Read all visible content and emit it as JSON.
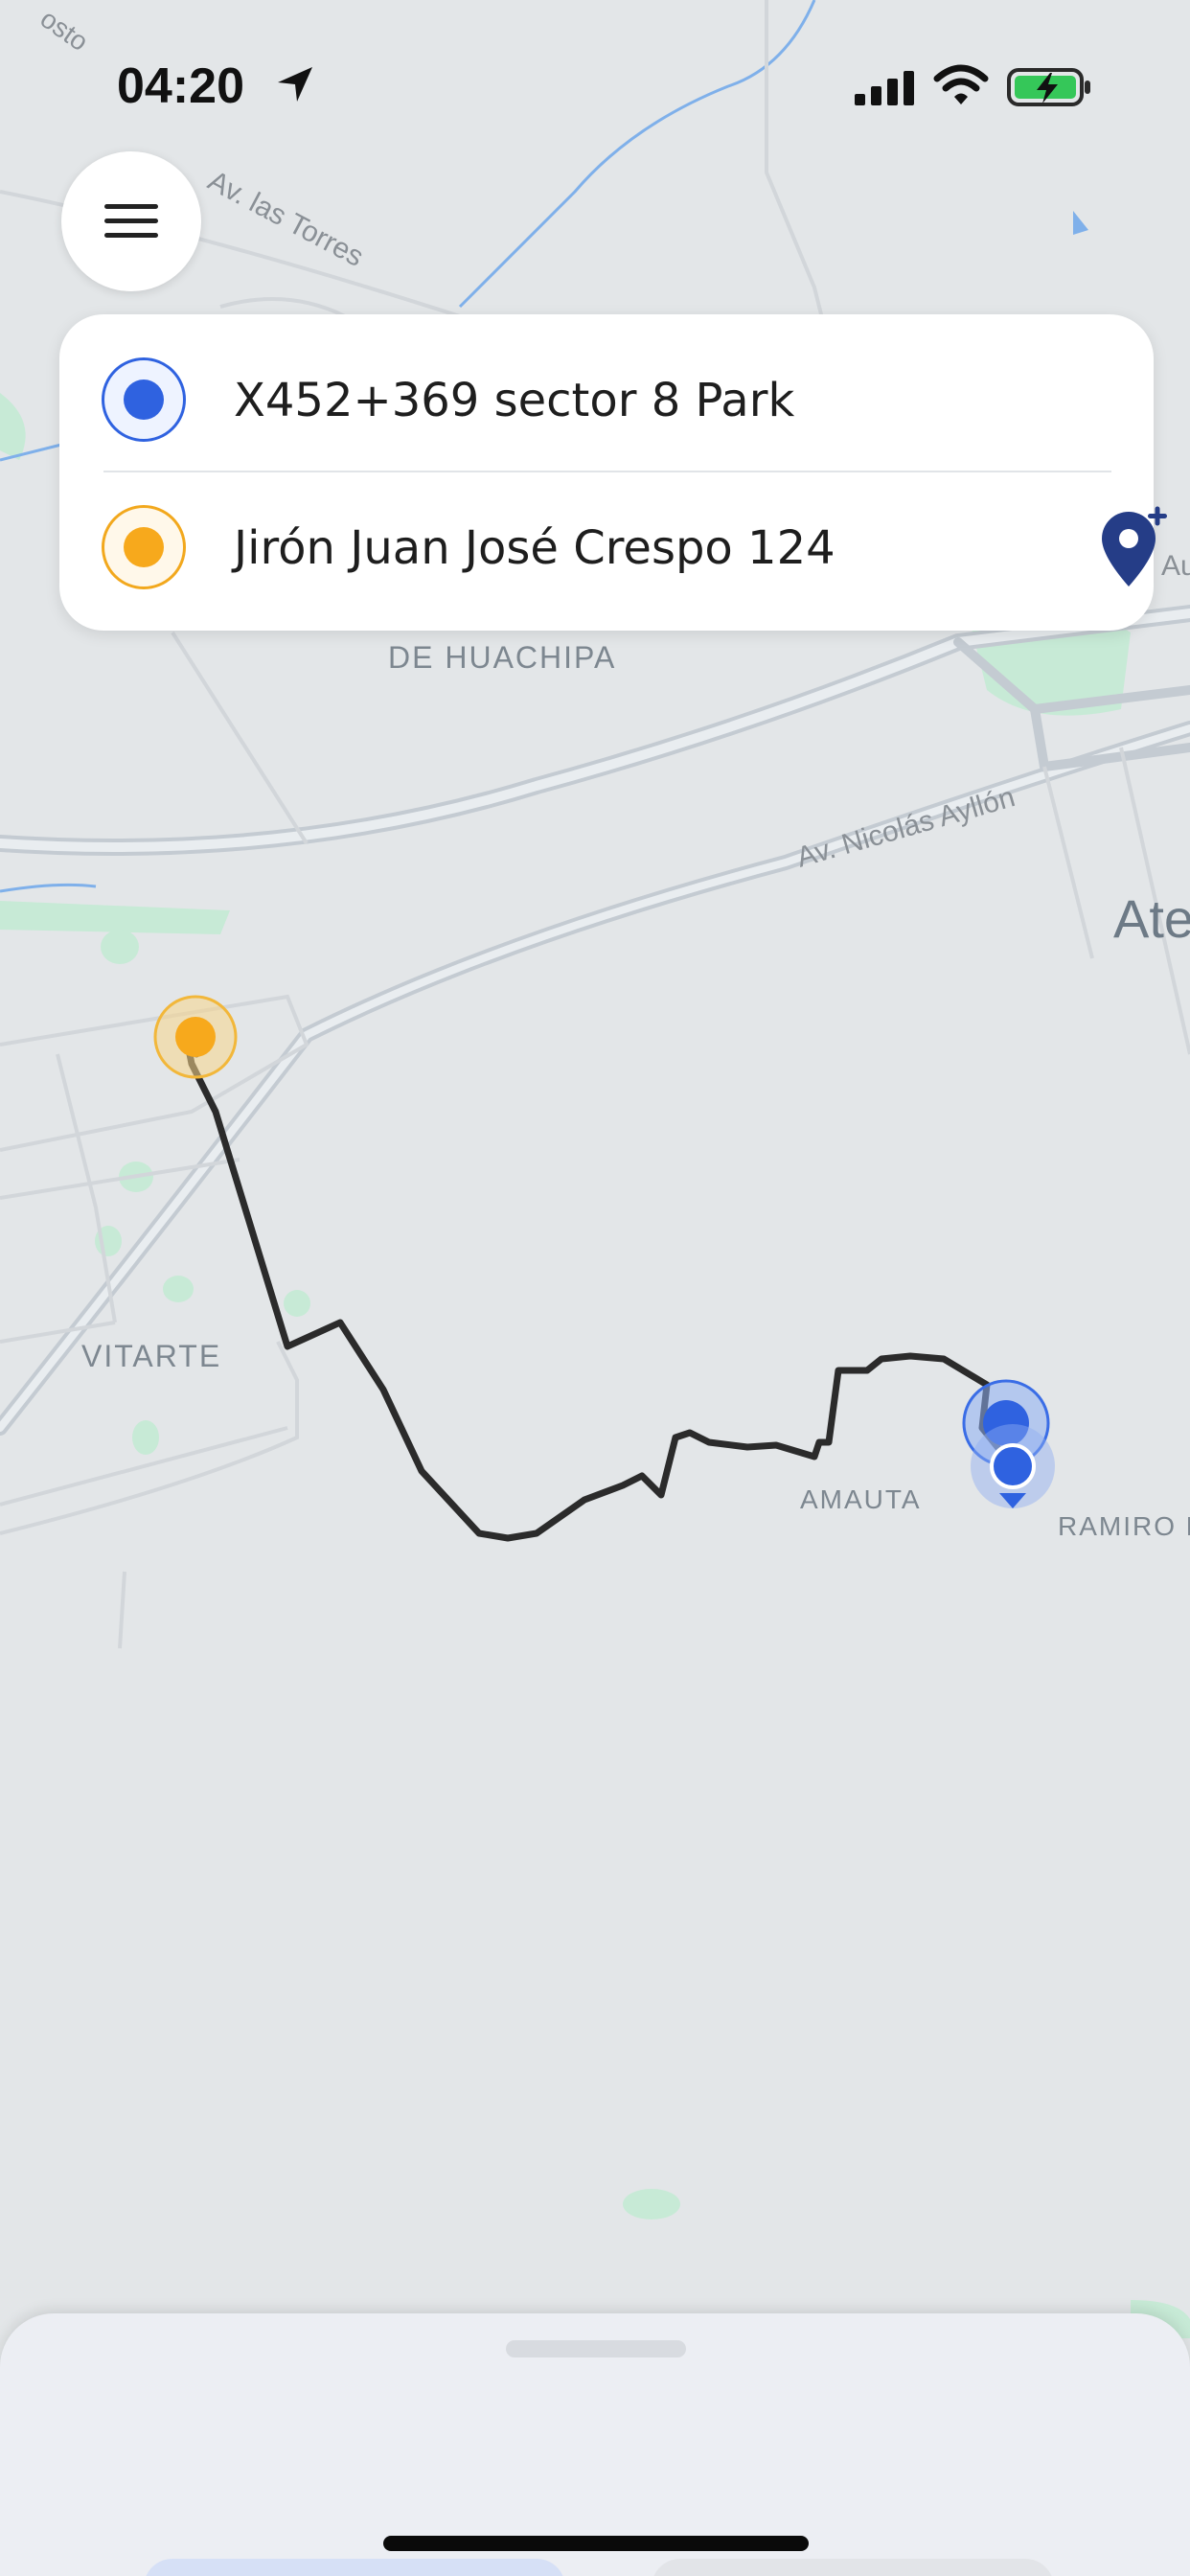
{
  "status_bar": {
    "time": "04:20",
    "icons": [
      "location-arrow-icon",
      "cellular-signal-icon",
      "wifi-icon",
      "battery-charging-icon"
    ]
  },
  "header": {
    "menu_icon": "hamburger-menu-icon"
  },
  "route": {
    "origin": "X452+369 sector 8 Park",
    "destination": "Jirón Juan José Crespo 124",
    "add_stop_icon": "add-location-pin-icon"
  },
  "map": {
    "labels": {
      "street_top": "Av. las Torres",
      "street_top_partial": "osto",
      "district_huachipa": "DE HUACHIPA",
      "avenue_ayllon": "Av. Nicolás Ayllón",
      "district_ate": "Ate",
      "district_vitarte": "VITARTE",
      "district_amauta": "AMAUTA",
      "district_ramiro": "RAMIRO P",
      "edge_text": "Au"
    }
  },
  "colors": {
    "origin": "#2f62e0",
    "destination": "#f7a91c",
    "route_line": "#2b2b2b",
    "map_background": "#e3e6e8",
    "river": "#6aa0e6",
    "park": "#bfe8cf"
  },
  "bottom_sheet": {
    "handle_icon": "drag-handle"
  }
}
